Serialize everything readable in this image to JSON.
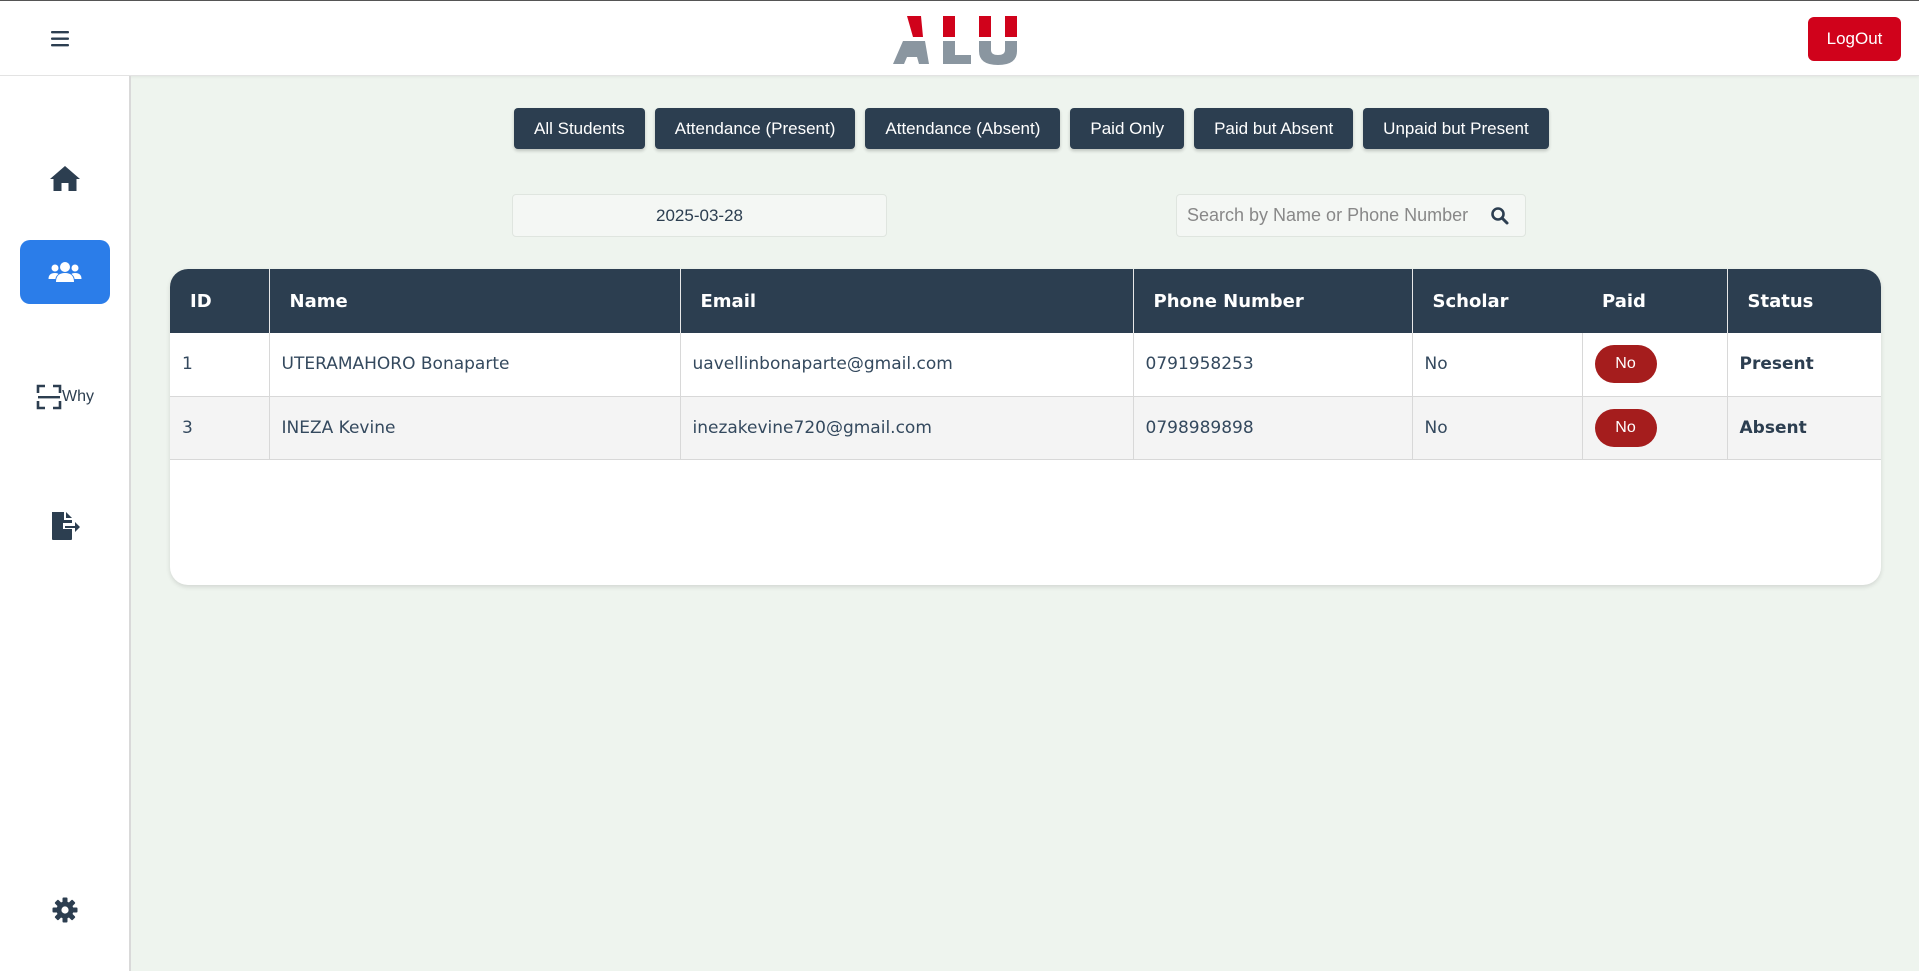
{
  "header": {
    "logo_text": "ALU",
    "logout_label": "LogOut"
  },
  "sidebar": {
    "items": [
      {
        "icon": "home-icon",
        "active": false
      },
      {
        "icon": "users-icon",
        "active": true
      },
      {
        "icon": "scan-icon",
        "active": false
      },
      {
        "icon": "file-export-icon",
        "active": false
      },
      {
        "icon": "gear-icon",
        "active": false
      }
    ]
  },
  "filters": [
    "All Students",
    "Attendance (Present)",
    "Attendance (Absent)",
    "Paid Only",
    "Paid but Absent",
    "Unpaid but Present"
  ],
  "date": {
    "value": "2025-03-28"
  },
  "search": {
    "placeholder": "Search by Name or Phone Number",
    "value": ""
  },
  "table": {
    "headers": [
      "ID",
      "Name",
      "Email",
      "Phone Number",
      "Scholar",
      "Paid",
      "Status"
    ],
    "rows": [
      {
        "id": "1",
        "name": "UTERAMAHORO Bonaparte",
        "email": "uavellinbonaparte@gmail.com",
        "phone": "0791958253",
        "scholar": "No",
        "paid": "No",
        "status": "Present"
      },
      {
        "id": "3",
        "name": "INEZA Kevine",
        "email": "inezakevine720@gmail.com",
        "phone": "0798989898",
        "scholar": "No",
        "paid": "No",
        "status": "Absent"
      }
    ]
  },
  "colors": {
    "primary_dark": "#2c3e50",
    "accent_blue": "#2b7de9",
    "logout_red": "#d0021b",
    "paid_badge_red": "#a51d1d",
    "background": "#eef4ee"
  }
}
